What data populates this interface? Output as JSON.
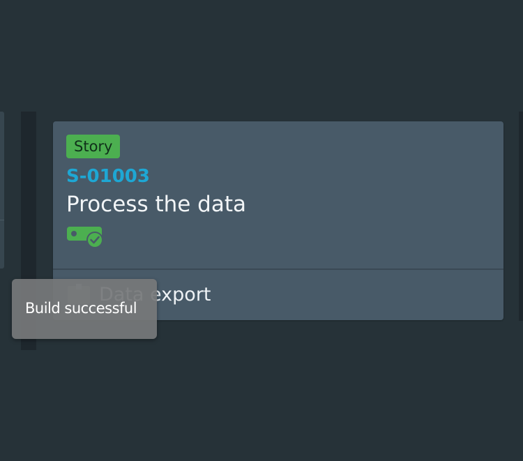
{
  "card": {
    "type": "Story",
    "id": "S-01003",
    "title": "Process the data",
    "build_status_icon": "build-success-icon",
    "feature": {
      "icon": "feature-icon",
      "label": "Data export"
    }
  },
  "tooltip": {
    "text": "Build successful"
  },
  "colors": {
    "background": "#263238",
    "card": "#485a68",
    "story_badge": "#4caf50",
    "id_link": "#1ea7d4",
    "success": "#4caf50",
    "tooltip": "#76787a"
  }
}
